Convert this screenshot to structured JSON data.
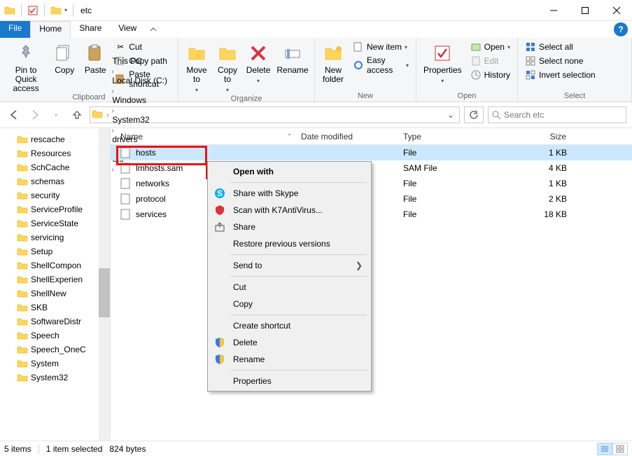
{
  "window": {
    "title": "etc"
  },
  "tabs": {
    "file": "File",
    "home": "Home",
    "share": "Share",
    "view": "View"
  },
  "ribbon": {
    "clipboard": {
      "label": "Clipboard",
      "pin": "Pin to Quick\naccess",
      "copy": "Copy",
      "paste": "Paste",
      "cut": "Cut",
      "copy_path": "Copy path",
      "paste_shortcut": "Paste shortcut"
    },
    "organize": {
      "label": "Organize",
      "move_to": "Move\nto",
      "copy_to": "Copy\nto",
      "delete": "Delete",
      "rename": "Rename"
    },
    "new": {
      "label": "New",
      "new_folder": "New\nfolder",
      "new_item": "New item",
      "easy_access": "Easy access"
    },
    "open": {
      "label": "Open",
      "properties": "Properties",
      "open": "Open",
      "edit": "Edit",
      "history": "History"
    },
    "select": {
      "label": "Select",
      "select_all": "Select all",
      "select_none": "Select none",
      "invert": "Invert selection"
    }
  },
  "breadcrumbs": [
    "This PC",
    "Local Disk (C:)",
    "Windows",
    "System32",
    "drivers",
    "etc"
  ],
  "search": {
    "placeholder": "Search etc"
  },
  "tree": [
    "rescache",
    "Resources",
    "SchCache",
    "schemas",
    "security",
    "ServiceProfile",
    "ServiceState",
    "servicing",
    "Setup",
    "ShellCompon",
    "ShellExperien",
    "ShellNew",
    "SKB",
    "SoftwareDistr",
    "Speech",
    "Speech_OneC",
    "System",
    "System32"
  ],
  "columns": {
    "name": "Name",
    "date": "Date modified",
    "type": "Type",
    "size": "Size"
  },
  "files": [
    {
      "name": "hosts",
      "date": "",
      "type": "File",
      "size": "1 KB",
      "selected": true
    },
    {
      "name": "lmhosts.sam",
      "date": "",
      "type": "SAM File",
      "size": "4 KB",
      "selected": false
    },
    {
      "name": "networks",
      "date": "",
      "type": "File",
      "size": "1 KB",
      "selected": false
    },
    {
      "name": "protocol",
      "date": "",
      "type": "File",
      "size": "2 KB",
      "selected": false
    },
    {
      "name": "services",
      "date": "",
      "type": "File",
      "size": "18 KB",
      "selected": false
    }
  ],
  "context_menu": [
    {
      "label": "Open with",
      "bold": true,
      "icon": ""
    },
    {
      "sep": true
    },
    {
      "label": "Share with Skype",
      "icon": "skype"
    },
    {
      "label": "Scan with K7AntiVirus...",
      "icon": "k7"
    },
    {
      "label": "Share",
      "icon": "share"
    },
    {
      "label": "Restore previous versions",
      "icon": ""
    },
    {
      "sep": true
    },
    {
      "label": "Send to",
      "submenu": true,
      "icon": ""
    },
    {
      "sep": true
    },
    {
      "label": "Cut",
      "icon": ""
    },
    {
      "label": "Copy",
      "icon": ""
    },
    {
      "sep": true
    },
    {
      "label": "Create shortcut",
      "icon": ""
    },
    {
      "label": "Delete",
      "icon": "shield"
    },
    {
      "label": "Rename",
      "icon": "shield"
    },
    {
      "sep": true
    },
    {
      "label": "Properties",
      "icon": ""
    }
  ],
  "status": {
    "count": "5 items",
    "selection": "1 item selected",
    "bytes": "824 bytes"
  }
}
